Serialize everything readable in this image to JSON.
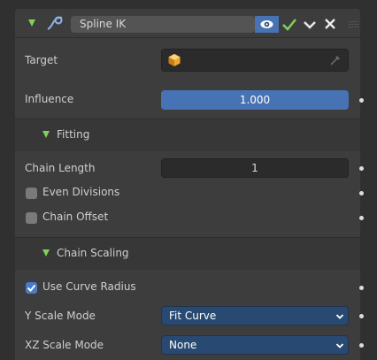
{
  "header": {
    "name_value": "Spline IK"
  },
  "target": {
    "label": "Target"
  },
  "influence": {
    "label": "Influence",
    "value": "1.000"
  },
  "fitting": {
    "label": "Fitting",
    "chain_length_label": "Chain Length",
    "chain_length_value": "1",
    "even_divisions_label": "Even Divisions",
    "chain_offset_label": "Chain Offset"
  },
  "chain_scaling": {
    "label": "Chain Scaling",
    "use_curve_radius_label": "Use Curve Radius",
    "y_scale_mode_label": "Y Scale Mode",
    "y_scale_mode_value": "Fit Curve",
    "xz_scale_mode_label": "XZ Scale Mode",
    "xz_scale_mode_value": "None"
  },
  "colors": {
    "accent": "#4772b3",
    "check_green": "#7fd15a"
  }
}
